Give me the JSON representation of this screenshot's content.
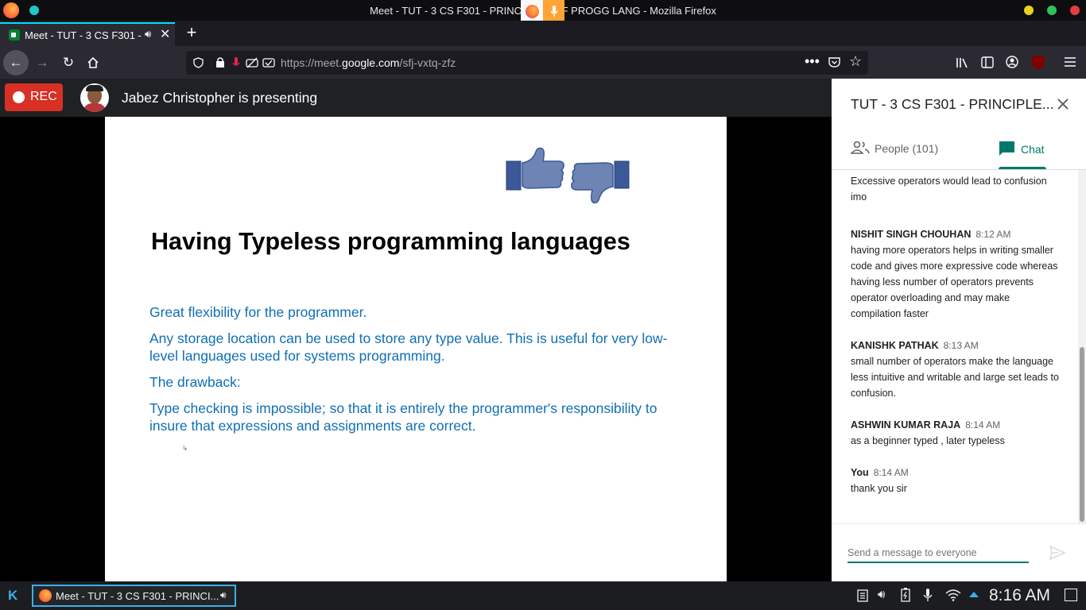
{
  "window": {
    "title": "Meet - TUT - 3 CS F301 - PRINCIPLES OF PROGG LANG - Mozilla Firefox"
  },
  "tab": {
    "label": "Meet - TUT - 3 CS F301 -"
  },
  "address": {
    "prefix": "https://meet.",
    "domain": "google.com",
    "path": "/sfj-vxtq-zfz"
  },
  "meet": {
    "rec_label": "REC",
    "presenting_text": "Jabez Christopher is presenting"
  },
  "slide": {
    "title": "Having Typeless programming languages",
    "points": [
      "Great flexibility for the programmer.",
      "Any storage location can be used to store any type value. This is useful for very low-level languages used for systems programming.",
      "The drawback:",
      "Type checking is impossible; so that it is entirely the programmer's responsibility to insure that expressions and assignments are correct."
    ]
  },
  "panel": {
    "title": "TUT - 3 CS F301 - PRINCIPLE...",
    "tab_people": "People (101)",
    "tab_chat": "Chat",
    "partial_message": "Excessive operators would lead to confusion imo",
    "messages": [
      {
        "sender": "NISHIT SINGH CHOUHAN",
        "time": "8:12 AM",
        "text": "having more operators helps in writing smaller code and gives more expressive code whereas having less number of operators prevents operator overloading and may make compilation faster"
      },
      {
        "sender": "KANISHK PATHAK",
        "time": "8:13 AM",
        "text": "small number of operators make the language less intuitive and writable and large set leads to confusion."
      },
      {
        "sender": "ASHWIN KUMAR RAJA",
        "time": "8:14 AM",
        "text": "as a beginner typed , later typeless"
      },
      {
        "sender": "You",
        "time": "8:14 AM",
        "text": "thank you sir"
      }
    ],
    "input_placeholder": "Send a message to everyone"
  },
  "taskbar": {
    "task_label": "Meet - TUT - 3 CS F301 - PRINCI...",
    "clock": "8:16 AM"
  },
  "colors": {
    "accent": "#00796b",
    "rec": "#d93025",
    "slide_text": "#0f6fb4"
  }
}
